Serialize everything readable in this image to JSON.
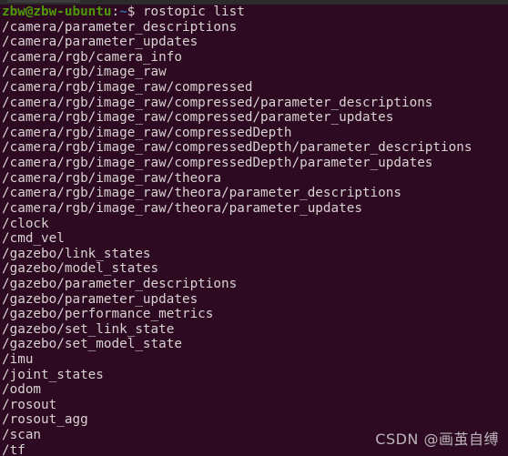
{
  "window": {
    "title_bar_visible_sliver": true,
    "background_color": "#2d0922",
    "foreground_color": "#d8d3d0",
    "titlebar_color": "#2b2b2b"
  },
  "prompt": {
    "user_host": "zbw@zbw-ubuntu",
    "separator": ":",
    "path": "~",
    "sigil": "$",
    "command": "rostopic list",
    "user_host_color": "#4e9a06",
    "path_color": "#3465a4"
  },
  "output": {
    "lines": [
      "/camera/parameter_descriptions",
      "/camera/parameter_updates",
      "/camera/rgb/camera_info",
      "/camera/rgb/image_raw",
      "/camera/rgb/image_raw/compressed",
      "/camera/rgb/image_raw/compressed/parameter_descriptions",
      "/camera/rgb/image_raw/compressed/parameter_updates",
      "/camera/rgb/image_raw/compressedDepth",
      "/camera/rgb/image_raw/compressedDepth/parameter_descriptions",
      "/camera/rgb/image_raw/compressedDepth/parameter_updates",
      "/camera/rgb/image_raw/theora",
      "/camera/rgb/image_raw/theora/parameter_descriptions",
      "/camera/rgb/image_raw/theora/parameter_updates",
      "/clock",
      "/cmd_vel",
      "/gazebo/link_states",
      "/gazebo/model_states",
      "/gazebo/parameter_descriptions",
      "/gazebo/parameter_updates",
      "/gazebo/performance_metrics",
      "/gazebo/set_link_state",
      "/gazebo/set_model_state",
      "/imu",
      "/joint_states",
      "/odom",
      "/rosout",
      "/rosout_agg",
      "/scan",
      "/tf"
    ]
  },
  "watermark": {
    "text": "CSDN @画茧自缚"
  }
}
